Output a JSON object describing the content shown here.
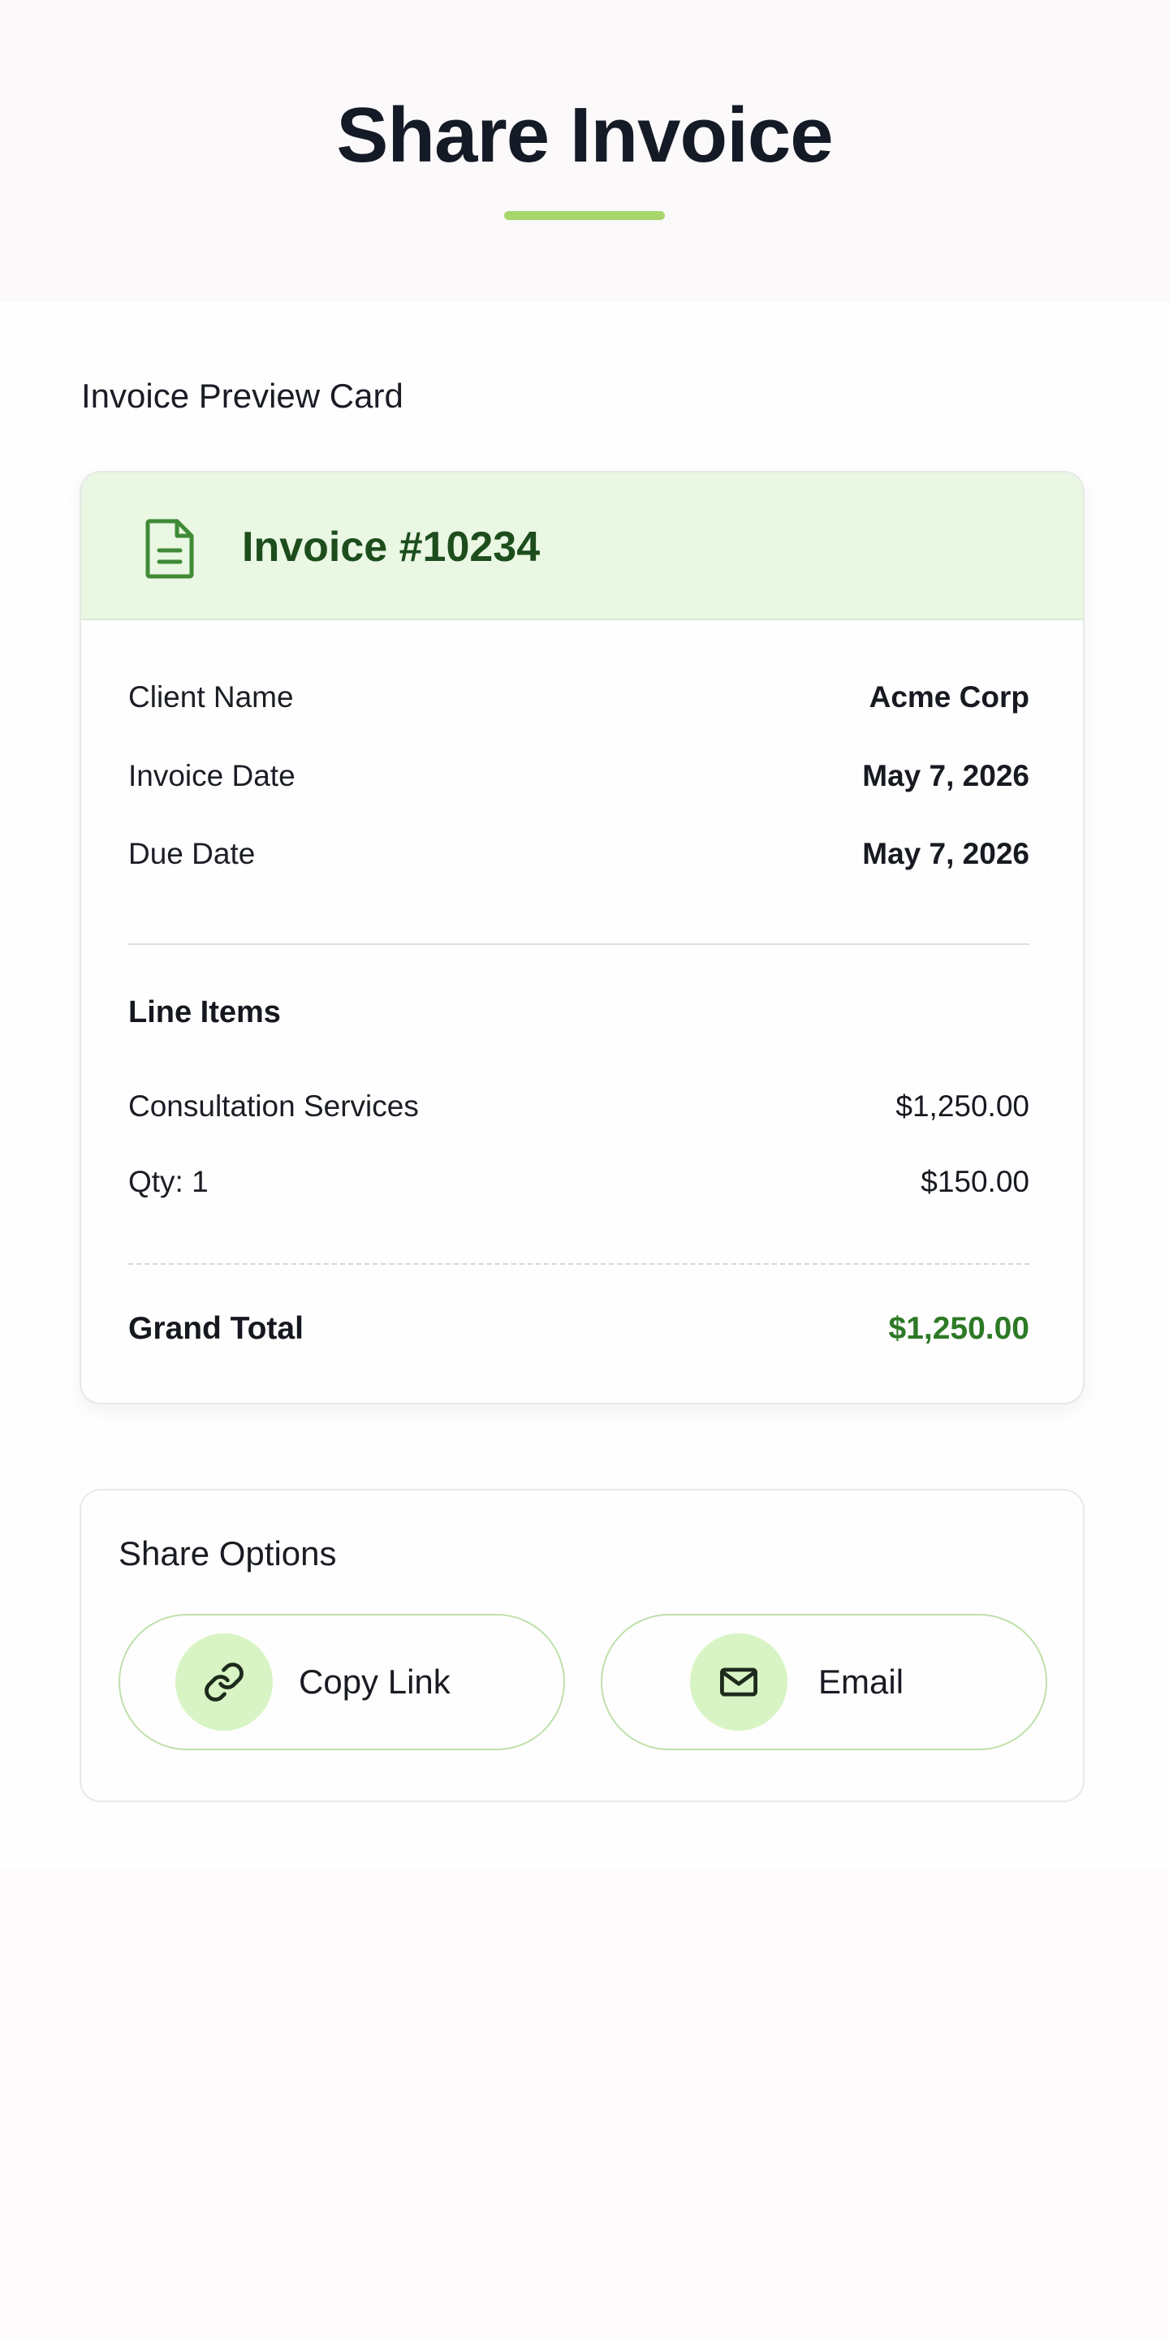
{
  "page": {
    "title": "Share Invoice",
    "accent_color": "#a6d66c"
  },
  "preview": {
    "section_label": "Invoice Preview Card",
    "icon": "document-icon",
    "invoice_number": "Invoice #10234",
    "details": [
      {
        "label": "Client Name",
        "value": "Acme Corp"
      },
      {
        "label": "Invoice Date",
        "value": "May 7, 2026"
      },
      {
        "label": "Due Date",
        "value": "May 7, 2026"
      }
    ],
    "line_items_heading": "Line Items",
    "line_items": [
      {
        "label": "Consultation Services",
        "amount": "$1,250.00"
      },
      {
        "label": "Qty: 1",
        "amount": "$150.00"
      }
    ],
    "grand_total_label": "Grand Total",
    "grand_total_value": "$1,250.00",
    "total_color": "#2d7a26"
  },
  "share": {
    "heading": "Share Options",
    "buttons": [
      {
        "label": "Copy Link",
        "icon": "link-icon"
      },
      {
        "label": "Email",
        "icon": "mail-icon"
      }
    ]
  }
}
